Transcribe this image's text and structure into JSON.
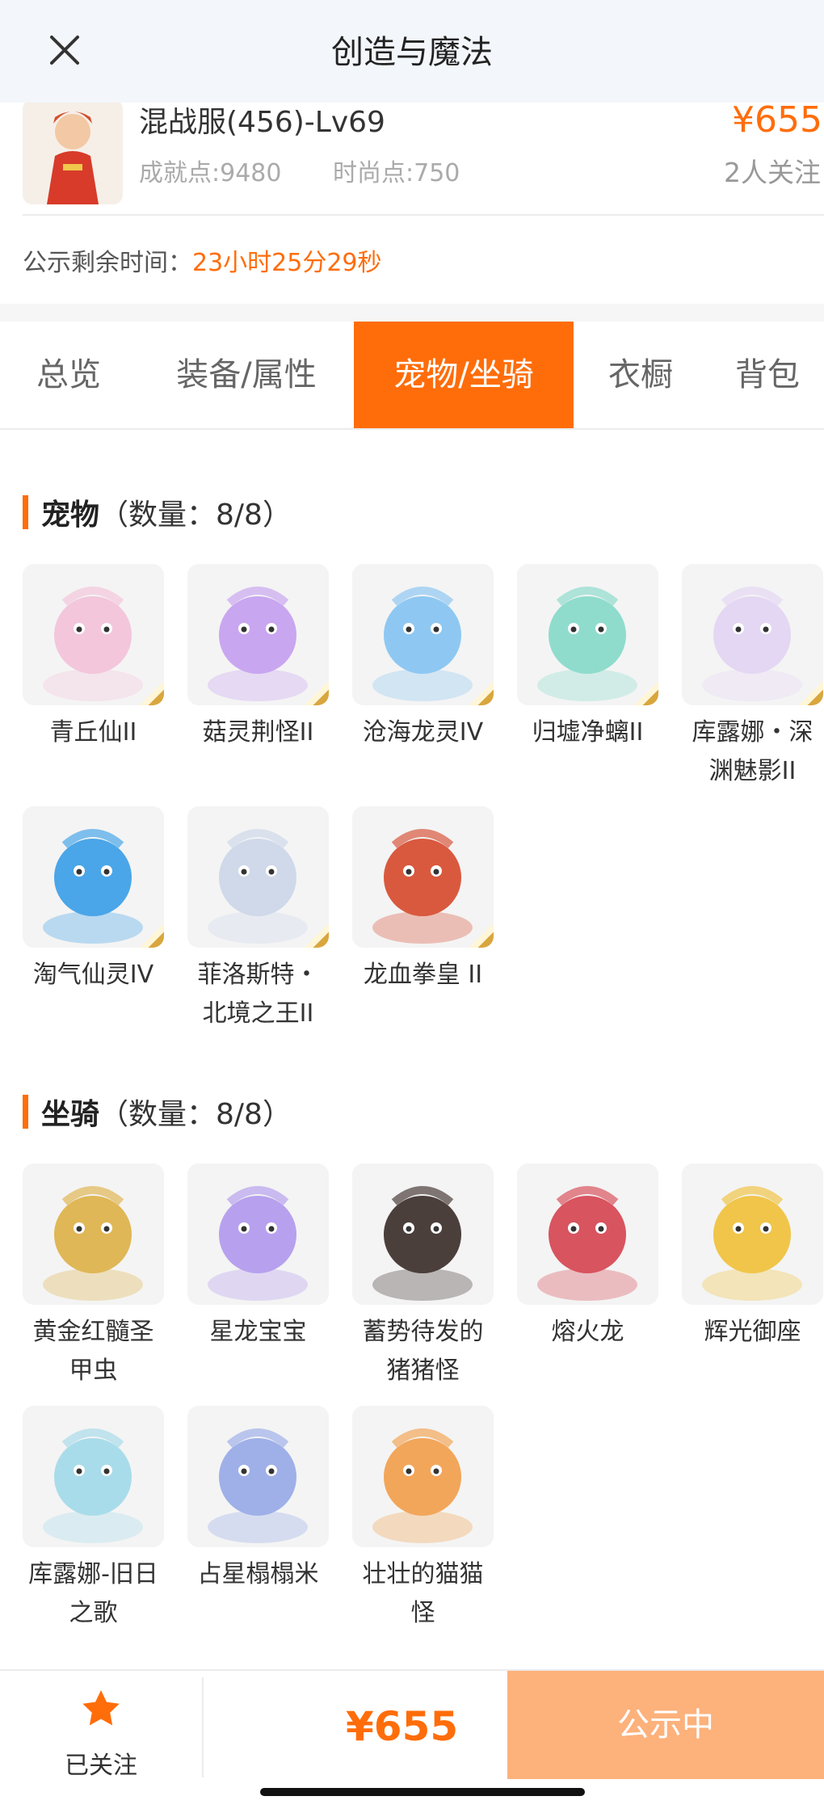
{
  "header": {
    "title": "创造与魔法",
    "close_icon": "close-icon"
  },
  "info": {
    "server_name": "混战服(456)-Lv69",
    "achievement": "成就点:9480",
    "fashion": "时尚点:750",
    "price": "¥655",
    "followers": "2人关注"
  },
  "countdown": {
    "label": "公示剩余时间：",
    "time": "23小时25分29秒"
  },
  "tabs": [
    "总览",
    "装备/属性",
    "宠物/坐骑",
    "衣橱",
    "背包"
  ],
  "active_tab": "宠物/坐骑",
  "pets": {
    "title": "宠物",
    "count": "（数量：8/8）",
    "items": [
      {
        "name": "青丘仙II",
        "grade": "II",
        "color": "#f3c6dc"
      },
      {
        "name": "菇灵荆怪II",
        "grade": "II",
        "color": "#c9a6f0"
      },
      {
        "name": "沧海龙灵IV",
        "grade": "IV",
        "color": "#8ec8f2"
      },
      {
        "name": "归墟净螭II",
        "grade": "II",
        "color": "#8fdccd"
      },
      {
        "name": "库露娜・深渊魅影II",
        "grade": "II",
        "color": "#e4d7f3"
      },
      {
        "name": "淘气仙灵IV",
        "grade": "IV",
        "color": "#4aa6e8"
      },
      {
        "name": "菲洛斯特・北境之王II",
        "grade": "II",
        "color": "#cfd9ea"
      },
      {
        "name": "龙血拳皇 II",
        "grade": "II",
        "color": "#d9593e"
      }
    ]
  },
  "mounts": {
    "title": "坐骑",
    "count": "（数量：8/8）",
    "items": [
      {
        "name": "黄金红髓圣甲虫",
        "color": "#e0b756"
      },
      {
        "name": "星龙宝宝",
        "color": "#b7a1ee"
      },
      {
        "name": "蓄势待发的猪猪怪",
        "color": "#4b3f3c"
      },
      {
        "name": "熔火龙",
        "color": "#d8545f"
      },
      {
        "name": "辉光御座",
        "color": "#f0c54a"
      },
      {
        "name": "库露娜-旧日之歌",
        "color": "#a9dcea"
      },
      {
        "name": "占星榻榻米",
        "color": "#9fb0e8"
      },
      {
        "name": "壮壮的猫猫怪",
        "color": "#f2a65a"
      }
    ]
  },
  "bottom": {
    "follow_label": "已关注",
    "price": "¥655",
    "status": "公示中",
    "follow_icon": "star-icon"
  },
  "colors": {
    "accent": "#ff6d0a",
    "status_button": "#fdb17b"
  }
}
